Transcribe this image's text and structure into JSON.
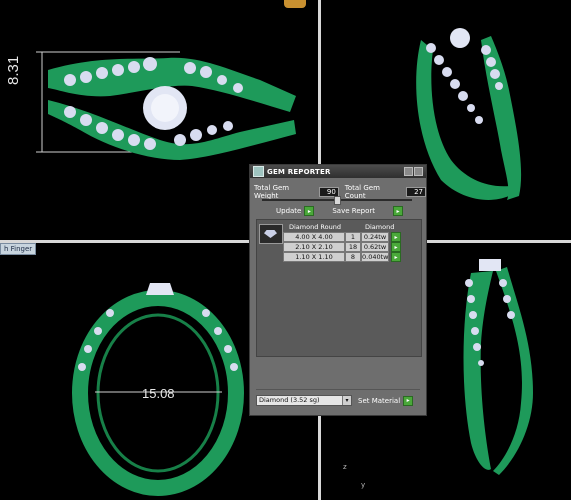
{
  "viewports": {
    "top_left": {
      "dimension_label": "8.31",
      "view_tab_label": "h Finger"
    },
    "bottom_left": {
      "dimension_label": "15.08"
    },
    "bottom_right": {
      "axis_z": "z",
      "axis_y": "y"
    }
  },
  "gem_reporter": {
    "title": "GEM REPORTER",
    "total_gem_weight_label": "Total Gem Weight",
    "total_gem_weight_value": "90",
    "total_gem_count_label": "Total Gem Count",
    "total_gem_count_value": "27",
    "update_label": "Update",
    "save_report_label": "Save Report",
    "table": {
      "headers": [
        "Diamond Round",
        "Diamond"
      ],
      "rows": [
        {
          "size": "4.00 X 4.00",
          "count": "1",
          "weight": "0.24tw"
        },
        {
          "size": "2.10 X 2.10",
          "count": "18",
          "weight": "0.62tw"
        },
        {
          "size": "1.10 X 1.10",
          "count": "8",
          "weight": "0.040tw"
        }
      ]
    },
    "material_select": {
      "value": "Diamond     (3.52 sg)"
    },
    "set_material_label": "Set Material"
  },
  "colors": {
    "ring_green": "#1e9a5a",
    "gem_white": "#dfe3f2",
    "accent_button": "#4aa83a"
  }
}
